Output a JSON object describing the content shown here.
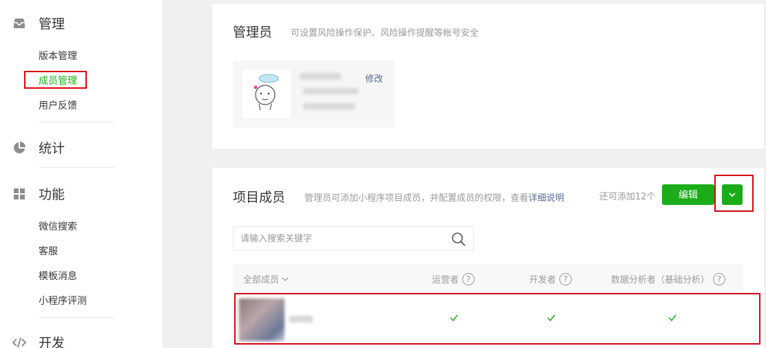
{
  "sidebar": {
    "manage": {
      "label": "管理",
      "items": [
        "版本管理",
        "成员管理",
        "用户反馈"
      ]
    },
    "stats": {
      "label": "统计"
    },
    "features": {
      "label": "功能",
      "items": [
        "微信搜索",
        "客服",
        "模板消息",
        "小程序评测"
      ]
    },
    "dev": {
      "label": "开发"
    }
  },
  "admin_card": {
    "title": "管理员",
    "desc": "可设置风险操作保护、风险操作提醒等帐号安全",
    "edit_label": "修改"
  },
  "members_card": {
    "title": "项目成员",
    "desc": "管理员可添加小程序项目成员，并配置成员的权限，查看",
    "desc_link": "详细说明",
    "quota": "还可添加12个",
    "edit_button": "编辑",
    "search_placeholder": "请输入搜索关键字",
    "columns": {
      "all": "全部成员",
      "operator": "运营者",
      "developer": "开发者",
      "analyst": "数据分析者（基础分析）"
    },
    "rows": [
      {
        "operator": true,
        "developer": true,
        "analyst": true
      }
    ]
  },
  "colors": {
    "accent_green": "#1aad19",
    "link_blue": "#576b95",
    "highlight_red": "#d9000f"
  }
}
